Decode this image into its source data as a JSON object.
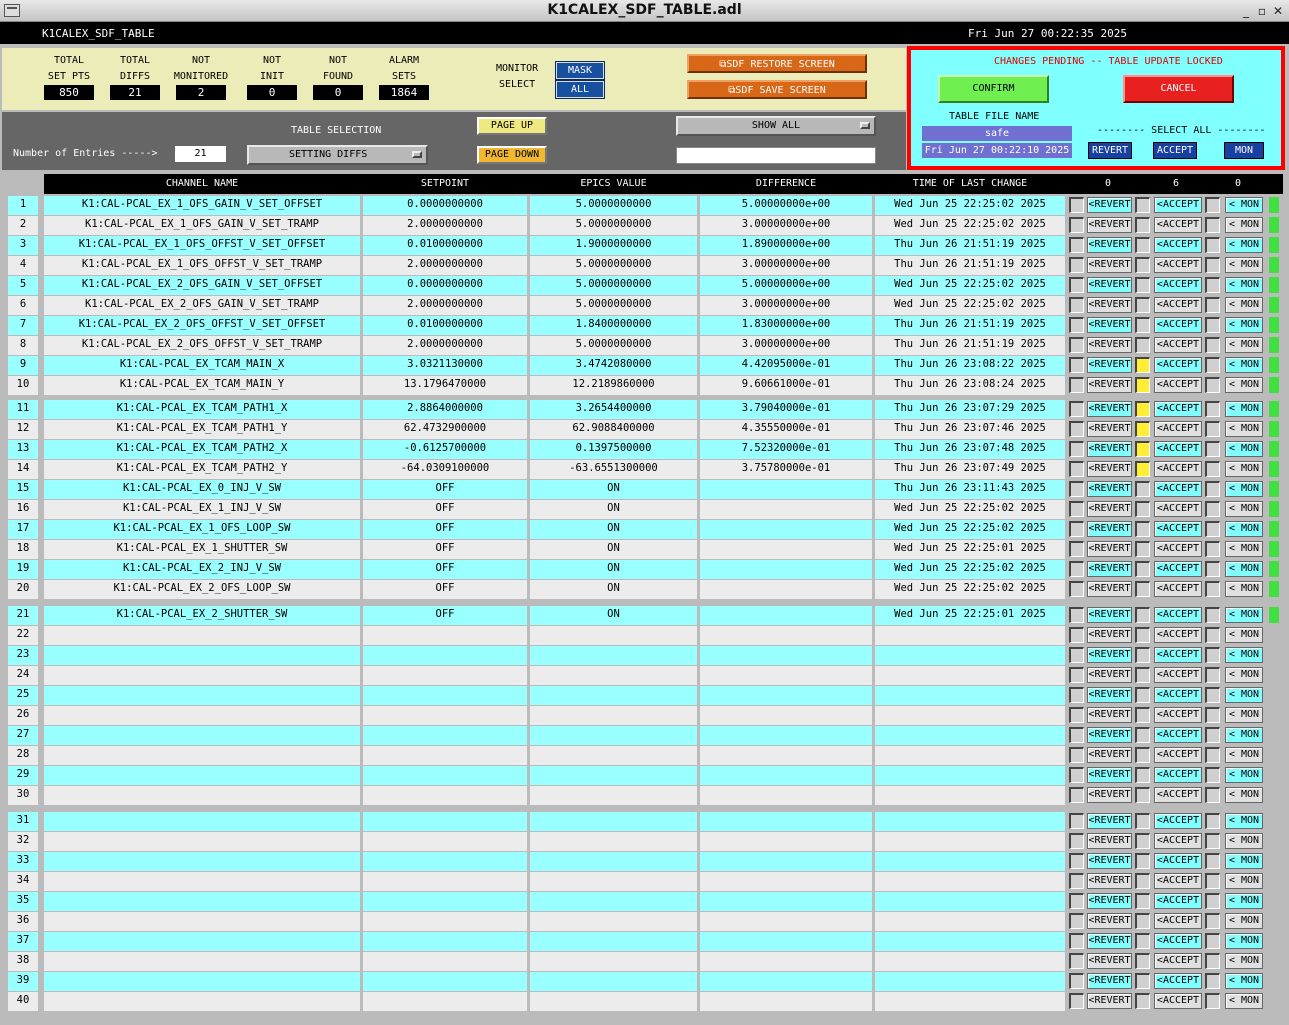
{
  "window": {
    "title": "K1CALEX_SDF_TABLE.adl"
  },
  "topbar": {
    "screen_name": "K1CALEX_SDF_TABLE",
    "clock": "Fri Jun 27 00:22:35 2025"
  },
  "stats": [
    {
      "label1": "TOTAL",
      "label2": "SET PTS",
      "value": "850"
    },
    {
      "label1": "TOTAL",
      "label2": "DIFFS",
      "value": "21"
    },
    {
      "label1": "NOT",
      "label2": "MONITORED",
      "value": "2"
    },
    {
      "label1": "NOT",
      "label2": "INIT",
      "value": "0"
    },
    {
      "label1": "NOT",
      "label2": "FOUND",
      "value": "0"
    },
    {
      "label1": "ALARM",
      "label2": "SETS",
      "value": "1864"
    }
  ],
  "monitor": {
    "label1": "MONITOR",
    "label2": "SELECT",
    "mask": "MASK",
    "all": "ALL"
  },
  "restore_button": "⧉SDF RESTORE SCREEN",
  "save_button": "⧉SDF SAVE SCREEN",
  "pending": {
    "message": "CHANGES PENDING -- TABLE UPDATE LOCKED",
    "confirm": "CONFIRM",
    "cancel": "CANCEL",
    "file_label": "TABLE FILE NAME",
    "file_name": "safe",
    "file_time": "Fri Jun 27 00:22:10 2025",
    "select_all": "-------- SELECT ALL --------",
    "revert": "REVERT",
    "accept": "ACCEPT",
    "mon": "MON"
  },
  "table_selection": {
    "entries_label": "Number of Entries ----->",
    "entries_value": "21",
    "label": "TABLE SELECTION",
    "value": "SETTING DIFFS",
    "page_up": "PAGE UP",
    "page_down": "PAGE DOWN",
    "show_all": "SHOW ALL",
    "search_value": ""
  },
  "columns": {
    "channel": "CHANNEL NAME",
    "setpoint": "SETPOINT",
    "epics": "EPICS VALUE",
    "diff": "DIFFERENCE",
    "time": "TIME OF LAST CHANGE",
    "count_revert": "0",
    "count_accept": "6",
    "count_mon": "0"
  },
  "buttons": {
    "revert": "<REVERT",
    "accept": "<ACCEPT",
    "mon": "< MON"
  },
  "rows": [
    {
      "n": "1",
      "ch": "K1:CAL-PCAL_EX_1_OFS_GAIN_V_SET_OFFSET",
      "sp": "0.0000000000",
      "ev": "5.0000000000",
      "df": "5.00000000e+00",
      "tm": "Wed Jun 25 22:25:02 2025",
      "acc": false,
      "ind": true
    },
    {
      "n": "2",
      "ch": "K1:CAL-PCAL_EX_1_OFS_GAIN_V_SET_TRAMP",
      "sp": "2.0000000000",
      "ev": "5.0000000000",
      "df": "3.00000000e+00",
      "tm": "Wed Jun 25 22:25:02 2025",
      "acc": false,
      "ind": true
    },
    {
      "n": "3",
      "ch": "K1:CAL-PCAL_EX_1_OFS_OFFST_V_SET_OFFSET",
      "sp": "0.0100000000",
      "ev": "1.9000000000",
      "df": "1.89000000e+00",
      "tm": "Thu Jun 26 21:51:19 2025",
      "acc": false,
      "ind": true
    },
    {
      "n": "4",
      "ch": "K1:CAL-PCAL_EX_1_OFS_OFFST_V_SET_TRAMP",
      "sp": "2.0000000000",
      "ev": "5.0000000000",
      "df": "3.00000000e+00",
      "tm": "Thu Jun 26 21:51:19 2025",
      "acc": false,
      "ind": true
    },
    {
      "n": "5",
      "ch": "K1:CAL-PCAL_EX_2_OFS_GAIN_V_SET_OFFSET",
      "sp": "0.0000000000",
      "ev": "5.0000000000",
      "df": "5.00000000e+00",
      "tm": "Wed Jun 25 22:25:02 2025",
      "acc": false,
      "ind": true
    },
    {
      "n": "6",
      "ch": "K1:CAL-PCAL_EX_2_OFS_GAIN_V_SET_TRAMP",
      "sp": "2.0000000000",
      "ev": "5.0000000000",
      "df": "3.00000000e+00",
      "tm": "Wed Jun 25 22:25:02 2025",
      "acc": false,
      "ind": true
    },
    {
      "n": "7",
      "ch": "K1:CAL-PCAL_EX_2_OFS_OFFST_V_SET_OFFSET",
      "sp": "0.0100000000",
      "ev": "1.8400000000",
      "df": "1.83000000e+00",
      "tm": "Thu Jun 26 21:51:19 2025",
      "acc": false,
      "ind": true
    },
    {
      "n": "8",
      "ch": "K1:CAL-PCAL_EX_2_OFS_OFFST_V_SET_TRAMP",
      "sp": "2.0000000000",
      "ev": "5.0000000000",
      "df": "3.00000000e+00",
      "tm": "Thu Jun 26 21:51:19 2025",
      "acc": false,
      "ind": true
    },
    {
      "n": "9",
      "ch": "K1:CAL-PCAL_EX_TCAM_MAIN_X",
      "sp": "3.0321130000",
      "ev": "3.4742080000",
      "df": "4.42095000e-01",
      "tm": "Thu Jun 26 23:08:22 2025",
      "acc": true,
      "ind": true
    },
    {
      "n": "10",
      "ch": "K1:CAL-PCAL_EX_TCAM_MAIN_Y",
      "sp": "13.1796470000",
      "ev": "12.2189860000",
      "df": "9.60661000e-01",
      "tm": "Thu Jun 26 23:08:24 2025",
      "acc": true,
      "ind": true
    },
    {
      "n": "11",
      "ch": "K1:CAL-PCAL_EX_TCAM_PATH1_X",
      "sp": "2.8864000000",
      "ev": "3.2654400000",
      "df": "3.79040000e-01",
      "tm": "Thu Jun 26 23:07:29 2025",
      "acc": true,
      "ind": true
    },
    {
      "n": "12",
      "ch": "K1:CAL-PCAL_EX_TCAM_PATH1_Y",
      "sp": "62.4732900000",
      "ev": "62.9088400000",
      "df": "4.35550000e-01",
      "tm": "Thu Jun 26 23:07:46 2025",
      "acc": true,
      "ind": true
    },
    {
      "n": "13",
      "ch": "K1:CAL-PCAL_EX_TCAM_PATH2_X",
      "sp": "-0.6125700000",
      "ev": "0.1397500000",
      "df": "7.52320000e-01",
      "tm": "Thu Jun 26 23:07:48 2025",
      "acc": true,
      "ind": true
    },
    {
      "n": "14",
      "ch": "K1:CAL-PCAL_EX_TCAM_PATH2_Y",
      "sp": "-64.0309100000",
      "ev": "-63.6551300000",
      "df": "3.75780000e-01",
      "tm": "Thu Jun 26 23:07:49 2025",
      "acc": true,
      "ind": true
    },
    {
      "n": "15",
      "ch": "K1:CAL-PCAL_EX_0_INJ_V_SW",
      "sp": "OFF",
      "ev": "ON",
      "df": "",
      "tm": "Thu Jun 26 23:11:43 2025",
      "acc": false,
      "ind": true
    },
    {
      "n": "16",
      "ch": "K1:CAL-PCAL_EX_1_INJ_V_SW",
      "sp": "OFF",
      "ev": "ON",
      "df": "",
      "tm": "Wed Jun 25 22:25:02 2025",
      "acc": false,
      "ind": true
    },
    {
      "n": "17",
      "ch": "K1:CAL-PCAL_EX_1_OFS_LOOP_SW",
      "sp": "OFF",
      "ev": "ON",
      "df": "",
      "tm": "Wed Jun 25 22:25:02 2025",
      "acc": false,
      "ind": true
    },
    {
      "n": "18",
      "ch": "K1:CAL-PCAL_EX_1_SHUTTER_SW",
      "sp": "OFF",
      "ev": "ON",
      "df": "",
      "tm": "Wed Jun 25 22:25:01 2025",
      "acc": false,
      "ind": true
    },
    {
      "n": "19",
      "ch": "K1:CAL-PCAL_EX_2_INJ_V_SW",
      "sp": "OFF",
      "ev": "ON",
      "df": "",
      "tm": "Wed Jun 25 22:25:02 2025",
      "acc": false,
      "ind": true
    },
    {
      "n": "20",
      "ch": "K1:CAL-PCAL_EX_2_OFS_LOOP_SW",
      "sp": "OFF",
      "ev": "ON",
      "df": "",
      "tm": "Wed Jun 25 22:25:02 2025",
      "acc": false,
      "ind": true
    },
    {
      "n": "21",
      "ch": "K1:CAL-PCAL_EX_2_SHUTTER_SW",
      "sp": "OFF",
      "ev": "ON",
      "df": "",
      "tm": "Wed Jun 25 22:25:01 2025",
      "acc": false,
      "ind": true
    },
    {
      "n": "22",
      "ch": "",
      "sp": "",
      "ev": "",
      "df": "",
      "tm": "",
      "acc": false,
      "ind": false
    },
    {
      "n": "23",
      "ch": "",
      "sp": "",
      "ev": "",
      "df": "",
      "tm": "",
      "acc": false,
      "ind": false
    },
    {
      "n": "24",
      "ch": "",
      "sp": "",
      "ev": "",
      "df": "",
      "tm": "",
      "acc": false,
      "ind": false
    },
    {
      "n": "25",
      "ch": "",
      "sp": "",
      "ev": "",
      "df": "",
      "tm": "",
      "acc": false,
      "ind": false
    },
    {
      "n": "26",
      "ch": "",
      "sp": "",
      "ev": "",
      "df": "",
      "tm": "",
      "acc": false,
      "ind": false
    },
    {
      "n": "27",
      "ch": "",
      "sp": "",
      "ev": "",
      "df": "",
      "tm": "",
      "acc": false,
      "ind": false
    },
    {
      "n": "28",
      "ch": "",
      "sp": "",
      "ev": "",
      "df": "",
      "tm": "",
      "acc": false,
      "ind": false
    },
    {
      "n": "29",
      "ch": "",
      "sp": "",
      "ev": "",
      "df": "",
      "tm": "",
      "acc": false,
      "ind": false
    },
    {
      "n": "30",
      "ch": "",
      "sp": "",
      "ev": "",
      "df": "",
      "tm": "",
      "acc": false,
      "ind": false
    },
    {
      "n": "31",
      "ch": "",
      "sp": "",
      "ev": "",
      "df": "",
      "tm": "",
      "acc": false,
      "ind": false
    },
    {
      "n": "32",
      "ch": "",
      "sp": "",
      "ev": "",
      "df": "",
      "tm": "",
      "acc": false,
      "ind": false
    },
    {
      "n": "33",
      "ch": "",
      "sp": "",
      "ev": "",
      "df": "",
      "tm": "",
      "acc": false,
      "ind": false
    },
    {
      "n": "34",
      "ch": "",
      "sp": "",
      "ev": "",
      "df": "",
      "tm": "",
      "acc": false,
      "ind": false
    },
    {
      "n": "35",
      "ch": "",
      "sp": "",
      "ev": "",
      "df": "",
      "tm": "",
      "acc": false,
      "ind": false
    },
    {
      "n": "36",
      "ch": "",
      "sp": "",
      "ev": "",
      "df": "",
      "tm": "",
      "acc": false,
      "ind": false
    },
    {
      "n": "37",
      "ch": "",
      "sp": "",
      "ev": "",
      "df": "",
      "tm": "",
      "acc": false,
      "ind": false
    },
    {
      "n": "38",
      "ch": "",
      "sp": "",
      "ev": "",
      "df": "",
      "tm": "",
      "acc": false,
      "ind": false
    },
    {
      "n": "39",
      "ch": "",
      "sp": "",
      "ev": "",
      "df": "",
      "tm": "",
      "acc": false,
      "ind": false
    },
    {
      "n": "40",
      "ch": "",
      "sp": "",
      "ev": "",
      "df": "",
      "tm": "",
      "acc": false,
      "ind": false
    }
  ],
  "colors": {
    "cyan_row": "#99ffff",
    "gray_row": "#ececec",
    "accept_active": "#ffee33",
    "indicator": "#40e040",
    "pending_bg": "#80ffff",
    "pending_border": "#ff0000"
  }
}
